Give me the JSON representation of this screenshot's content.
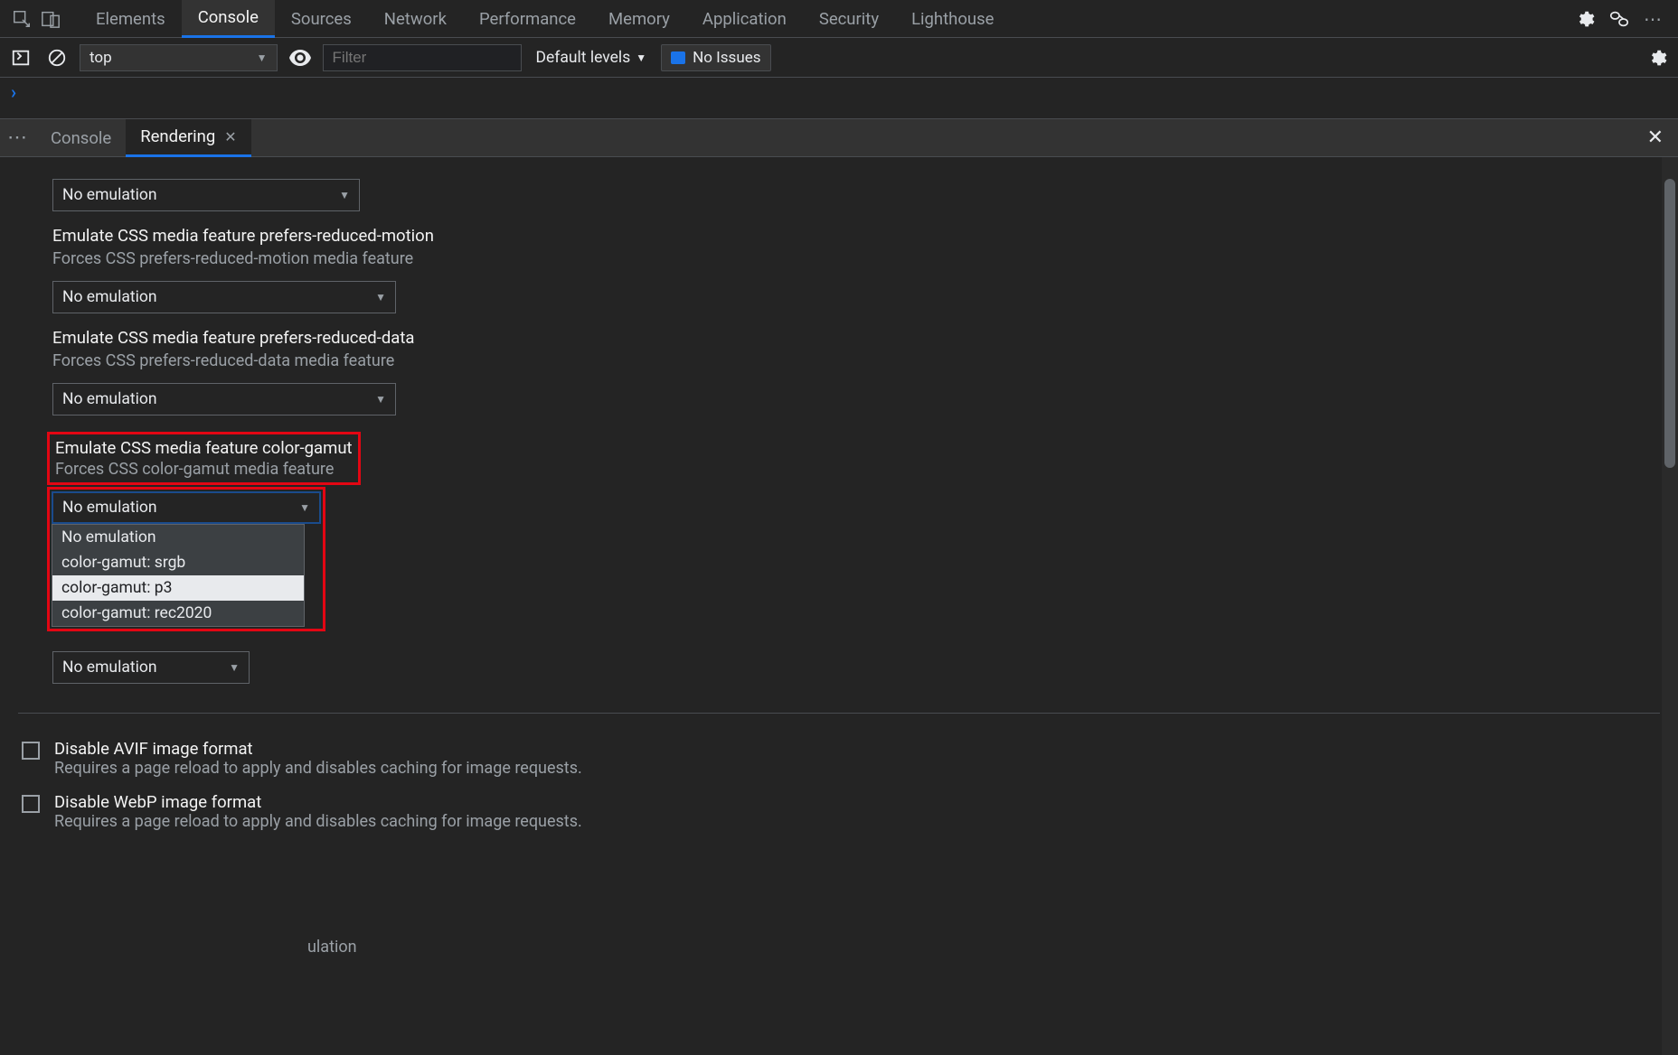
{
  "topTabs": {
    "elements": "Elements",
    "console": "Console",
    "sources": "Sources",
    "network": "Network",
    "performance": "Performance",
    "memory": "Memory",
    "application": "Application",
    "security": "Security",
    "lighthouse": "Lighthouse"
  },
  "consoleBar": {
    "context": "top",
    "filterPlaceholder": "Filter",
    "levels": "Default levels",
    "issues": "No Issues"
  },
  "drawer": {
    "consoleTab": "Console",
    "renderingTab": "Rendering"
  },
  "rendering": {
    "select0_value": "No emulation",
    "sec1_title": "Emulate CSS media feature prefers-reduced-motion",
    "sec1_desc": "Forces CSS prefers-reduced-motion media feature",
    "sec1_value": "No emulation",
    "sec2_title": "Emulate CSS media feature prefers-reduced-data",
    "sec2_desc": "Forces CSS prefers-reduced-data media feature",
    "sec2_value": "No emulation",
    "sec3_title": "Emulate CSS media feature color-gamut",
    "sec3_desc": "Forces CSS color-gamut media feature",
    "sec3_value": "No emulation",
    "sec3_options": {
      "o0": "No emulation",
      "o1": "color-gamut: srgb",
      "o2": "color-gamut: p3",
      "o3": "color-gamut: rec2020"
    },
    "behind_text": "ulation",
    "sec4_value": "No emulation",
    "avif_title": "Disable AVIF image format",
    "avif_desc": "Requires a page reload to apply and disables caching for image requests.",
    "webp_title": "Disable WebP image format",
    "webp_desc": "Requires a page reload to apply and disables caching for image requests."
  }
}
